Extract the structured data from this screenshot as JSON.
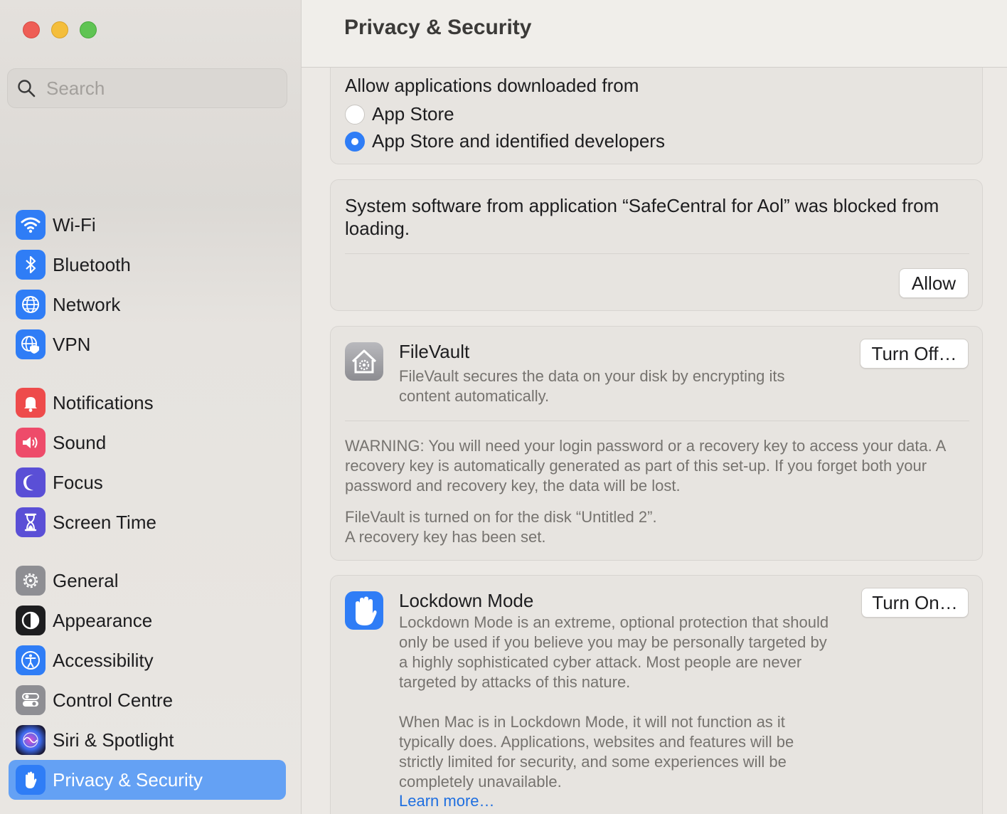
{
  "window": {
    "controls": [
      "close",
      "minimize",
      "maximize"
    ]
  },
  "sidebar": {
    "search": {
      "placeholder": "Search",
      "value": ""
    },
    "items": [
      {
        "label": "Wi-Fi",
        "icon": "wifi-icon",
        "color": "#2f7df6"
      },
      {
        "label": "Bluetooth",
        "icon": "bluetooth-icon",
        "color": "#2f7df6"
      },
      {
        "label": "Network",
        "icon": "globe-icon",
        "color": "#2f7df6"
      },
      {
        "label": "VPN",
        "icon": "vpn-globe-icon",
        "color": "#2f7df6"
      },
      {
        "label": "Notifications",
        "icon": "bell-icon",
        "color": "#ee4b4b"
      },
      {
        "label": "Sound",
        "icon": "speaker-icon",
        "color": "#ee4b6a"
      },
      {
        "label": "Focus",
        "icon": "moon-icon",
        "color": "#5a4fd6"
      },
      {
        "label": "Screen Time",
        "icon": "hourglass-icon",
        "color": "#5a4fd6"
      },
      {
        "label": "General",
        "icon": "gear-icon",
        "color": "#8e8e93"
      },
      {
        "label": "Appearance",
        "icon": "appearance-icon",
        "color": "#1d1d1f"
      },
      {
        "label": "Accessibility",
        "icon": "accessibility-icon",
        "color": "#2f7df6"
      },
      {
        "label": "Control Centre",
        "icon": "toggles-icon",
        "color": "#8e8e93"
      },
      {
        "label": "Siri & Spotlight",
        "icon": "siri-icon",
        "color": "#3a3a6a"
      },
      {
        "label": "Privacy & Security",
        "icon": "hand-icon",
        "color": "#2f7df6",
        "selected": true
      }
    ]
  },
  "main": {
    "title": "Privacy & Security",
    "downloads": {
      "heading": "Allow applications downloaded from",
      "options": [
        {
          "label": "App Store",
          "selected": false
        },
        {
          "label": "App Store and identified developers",
          "selected": true
        }
      ]
    },
    "blocked": {
      "message": "System software from application “SafeCentral for Aol” was blocked from loading.",
      "allow_label": "Allow"
    },
    "filevault": {
      "title": "FileVault",
      "description": "FileVault secures the data on your disk by encrypting its content automatically.",
      "button_label": "Turn Off…",
      "warning": "WARNING: You will need your login password or a recovery key to access your data. A recovery key is automatically generated as part of this set-up. If you forget both your password and recovery key, the data will be lost.",
      "status_line1": "FileVault is turned on for the disk “Untitled 2”.",
      "status_line2": "A recovery key has been set."
    },
    "lockdown": {
      "title": "Lockdown Mode",
      "description1": "Lockdown Mode is an extreme, optional protection that should only be used if you believe you may be personally targeted by a highly sophisticated cyber attack. Most people are never targeted by attacks of this nature.",
      "description2": "When Mac is in Lockdown Mode, it will not function as it typically does. Applications, websites and features will be strictly limited for security, and some experiences will be completely unavailable.",
      "learn_more": "Learn more…",
      "button_label": "Turn On…"
    }
  }
}
